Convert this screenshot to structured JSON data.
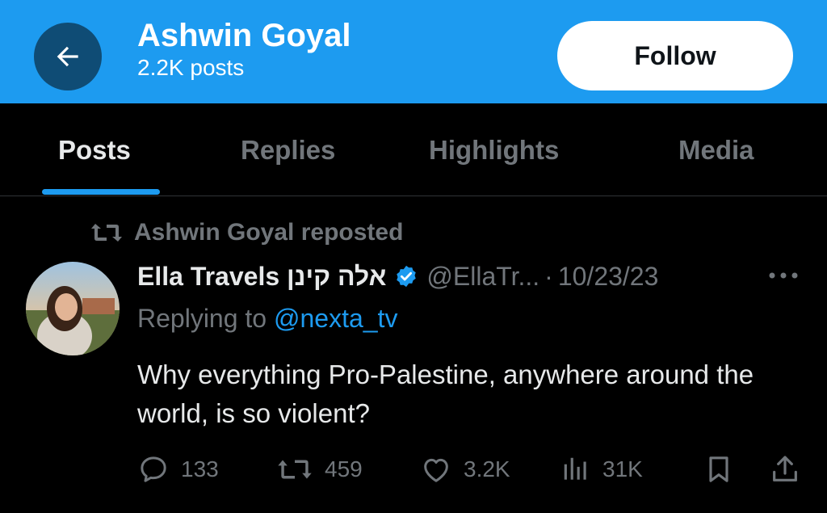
{
  "header": {
    "title": "Ashwin Goyal",
    "subtitle": "2.2K posts",
    "back_icon": "arrow-left-icon",
    "follow_label": "Follow"
  },
  "tabs": [
    {
      "label": "Posts",
      "active": true
    },
    {
      "label": "Replies",
      "active": false
    },
    {
      "label": "Highlights",
      "active": false
    },
    {
      "label": "Media",
      "active": false
    }
  ],
  "tweet": {
    "repost_label": "Ashwin Goyal reposted",
    "display_name": "Ella Travels אלה קינן",
    "verified": true,
    "handle": "@EllaTr...",
    "separator": "·",
    "date": "10/23/23",
    "replying_prefix": "Replying to",
    "replying_handle": "@nexta_tv",
    "text": "Why everything Pro-Palestine, anywhere around the world, is so violent?",
    "actions": {
      "replies": "133",
      "reposts": "459",
      "likes": "3.2K",
      "views": "31K"
    }
  },
  "colors": {
    "brand": "#1d9bf0",
    "background": "#000000",
    "muted": "#71767b",
    "text": "#e7e9ea"
  }
}
